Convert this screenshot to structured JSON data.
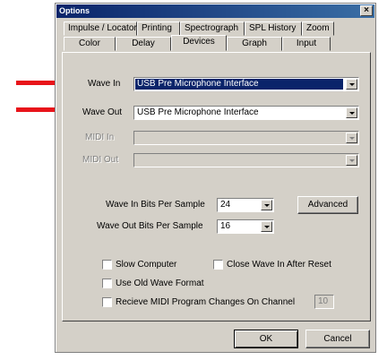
{
  "dialog": {
    "title": "Options",
    "close_glyph": "×"
  },
  "tabs_back": [
    "Impulse / Locator",
    "Printing",
    "Spectrograph",
    "SPL History",
    "Zoom"
  ],
  "tabs_front": [
    "Color",
    "Delay",
    "Devices",
    "Graph",
    "Input"
  ],
  "active_tab": "Devices",
  "devices": {
    "wave_in_label": "Wave In",
    "wave_in_value": "USB Pre Microphone Interface",
    "wave_out_label": "Wave Out",
    "wave_out_value": "USB Pre Microphone Interface",
    "midi_in_label": "MIDI In",
    "midi_out_label": "MIDI Out",
    "wave_in_bits_label": "Wave In Bits Per Sample",
    "wave_in_bits_value": "24",
    "wave_out_bits_label": "Wave Out Bits Per Sample",
    "wave_out_bits_value": "16",
    "advanced_label": "Advanced",
    "slow_computer_label": "Slow Computer",
    "close_wave_label": "Close Wave In After Reset",
    "old_wave_label": "Use Old Wave Format",
    "midi_program_label": "Recieve MIDI Program Changes On Channel",
    "midi_channel_value": "10"
  },
  "footer": {
    "ok_label": "OK",
    "cancel_label": "Cancel"
  },
  "colors": {
    "arrow": "#e8141a",
    "selection": "#0a246a",
    "face": "#d4d0c8"
  }
}
